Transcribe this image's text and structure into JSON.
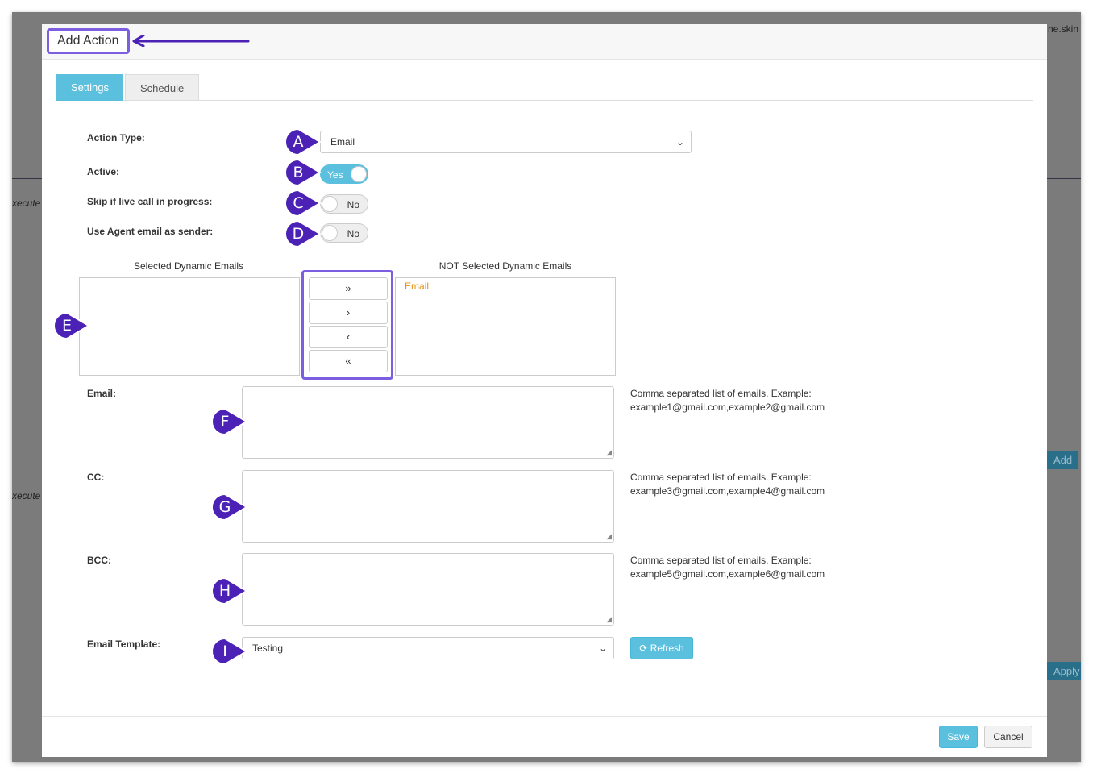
{
  "background": {
    "top_right_text": "ne.skin",
    "execute_text_1": "xecute",
    "execute_text_2": "xecute",
    "add_button": "Add",
    "apply_button": "Apply"
  },
  "modal": {
    "title": "Add Action",
    "tabs": [
      {
        "label": "Settings",
        "active": true
      },
      {
        "label": "Schedule",
        "active": false
      }
    ],
    "action_type": {
      "label": "Action Type:",
      "value": "Email"
    },
    "active": {
      "label": "Active:",
      "value": "Yes"
    },
    "skip_live_call": {
      "label": "Skip if live call in progress:",
      "value": "No"
    },
    "agent_email_sender": {
      "label": "Use Agent email as sender:",
      "value": "No"
    },
    "dynamic_emails": {
      "selected_caption": "Selected Dynamic Emails",
      "not_selected_caption": "NOT Selected Dynamic Emails",
      "selected_items": [],
      "not_selected_items": [
        "Email"
      ],
      "move_buttons": [
        "»",
        "›",
        "‹",
        "«"
      ]
    },
    "email": {
      "label": "Email:",
      "value": "",
      "help": "Comma separated list of emails. Example: example1@gmail.com,example2@gmail.com"
    },
    "cc": {
      "label": "CC:",
      "value": "",
      "help": "Comma separated list of emails. Example: example3@gmail.com,example4@gmail.com"
    },
    "bcc": {
      "label": "BCC:",
      "value": "",
      "help": "Comma separated list of emails. Example: example5@gmail.com,example6@gmail.com"
    },
    "email_template": {
      "label": "Email Template:",
      "value": "Testing",
      "refresh_label": "Refresh"
    },
    "footer": {
      "save_label": "Save",
      "cancel_label": "Cancel"
    }
  },
  "callouts": [
    "A",
    "B",
    "C",
    "D",
    "E",
    "F",
    "G",
    "H",
    "I"
  ],
  "colors": {
    "accent": "#5bc0de",
    "callout": "#4b22b5",
    "highlight": "#7b5fe0",
    "list_item": "#e8900c"
  }
}
